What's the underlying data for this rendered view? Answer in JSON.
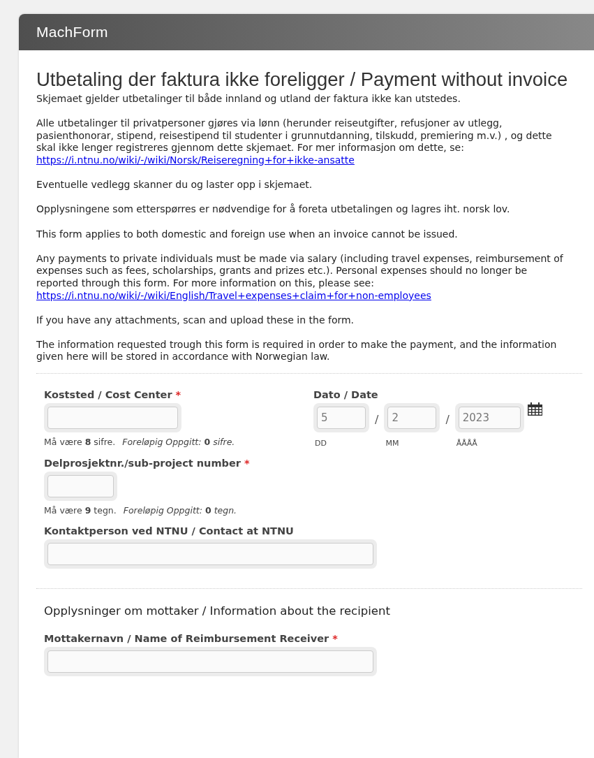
{
  "header": {
    "logo": "MachForm"
  },
  "form": {
    "title": "Utbetaling der faktura ikke foreligger / Payment without invoice",
    "description": [
      {
        "text": "Skjemaet gjelder utbetalinger til både innland og utland der faktura ikke kan utstedes."
      },
      {
        "text": "Alle utbetalinger til privatpersoner gjøres via lønn (herunder reiseutgifter, refusjoner av utlegg, pasienthonorar, stipend, reisestipend til studenter i grunnutdanning, tilskudd, premiering m.v.) , og dette skal ikke lenger registreres gjennom dette skjemaet. For mer informasjon om dette, se:",
        "link": "https://i.ntnu.no/wiki/-/wiki/Norsk/Reiseregning+for+ikke-ansatte"
      },
      {
        "text": "Eventuelle vedlegg skanner du og laster opp i skjemaet."
      },
      {
        "text": "Opplysningene som etterspørres er nødvendige for å foreta utbetalingen og lagres iht. norsk lov."
      },
      {
        "text": "This form applies to both domestic and foreign use when an invoice cannot be issued."
      },
      {
        "text": "Any payments to private individuals must be made via salary (including travel expenses, reimbursement of expenses such as fees, scholarships, grants and prizes etc.). Personal expenses should no longer be reported through this form. For more information on this, please see:",
        "link": "https://i.ntnu.no/wiki/-/wiki/English/Travel+expenses+claim+for+non-employees"
      },
      {
        "text": "If you have any attachments, scan and upload these in the form."
      },
      {
        "text": "The information requested trough this form is required in order to make the payment, and the information given here will be stored in accordance with Norwegian law."
      }
    ],
    "sections": [
      {
        "rows": [
          [
            {
              "kind": "short",
              "label": "Koststed / Cost Center",
              "marker": "*",
              "hint": "Må være **8** sifre.",
              "counter": "*Foreløpig Oppgitt:* **0** *sifre.*"
            },
            {
              "kind": "date",
              "label": "Dato / Date",
              "parts": [
                {
                  "value": "5",
                  "sublabel": "DD"
                },
                {
                  "separator": "/",
                  "value": "2",
                  "sublabel": "MM"
                },
                {
                  "separator": "/",
                  "value": "2023",
                  "sublabel": "ÅÅÅÅ"
                }
              ]
            }
          ],
          [
            {
              "kind": "tiny",
              "label": "Delprosjektnr./sub-project number",
              "marker": "*",
              "hint": "Må være **9** tegn.",
              "counter": "*Foreløpig Oppgitt:* **0** *tegn.*"
            }
          ],
          [
            {
              "kind": "wide",
              "label": "Kontaktperson ved NTNU / Contact at NTNU"
            }
          ]
        ]
      },
      {
        "heading": "Opplysninger om mottaker / Information about the recipient",
        "rows": [
          [
            {
              "kind": "wide",
              "label": "Mottakernavn / Name of Reimbursement Receiver",
              "marker": "*"
            }
          ]
        ]
      }
    ]
  }
}
